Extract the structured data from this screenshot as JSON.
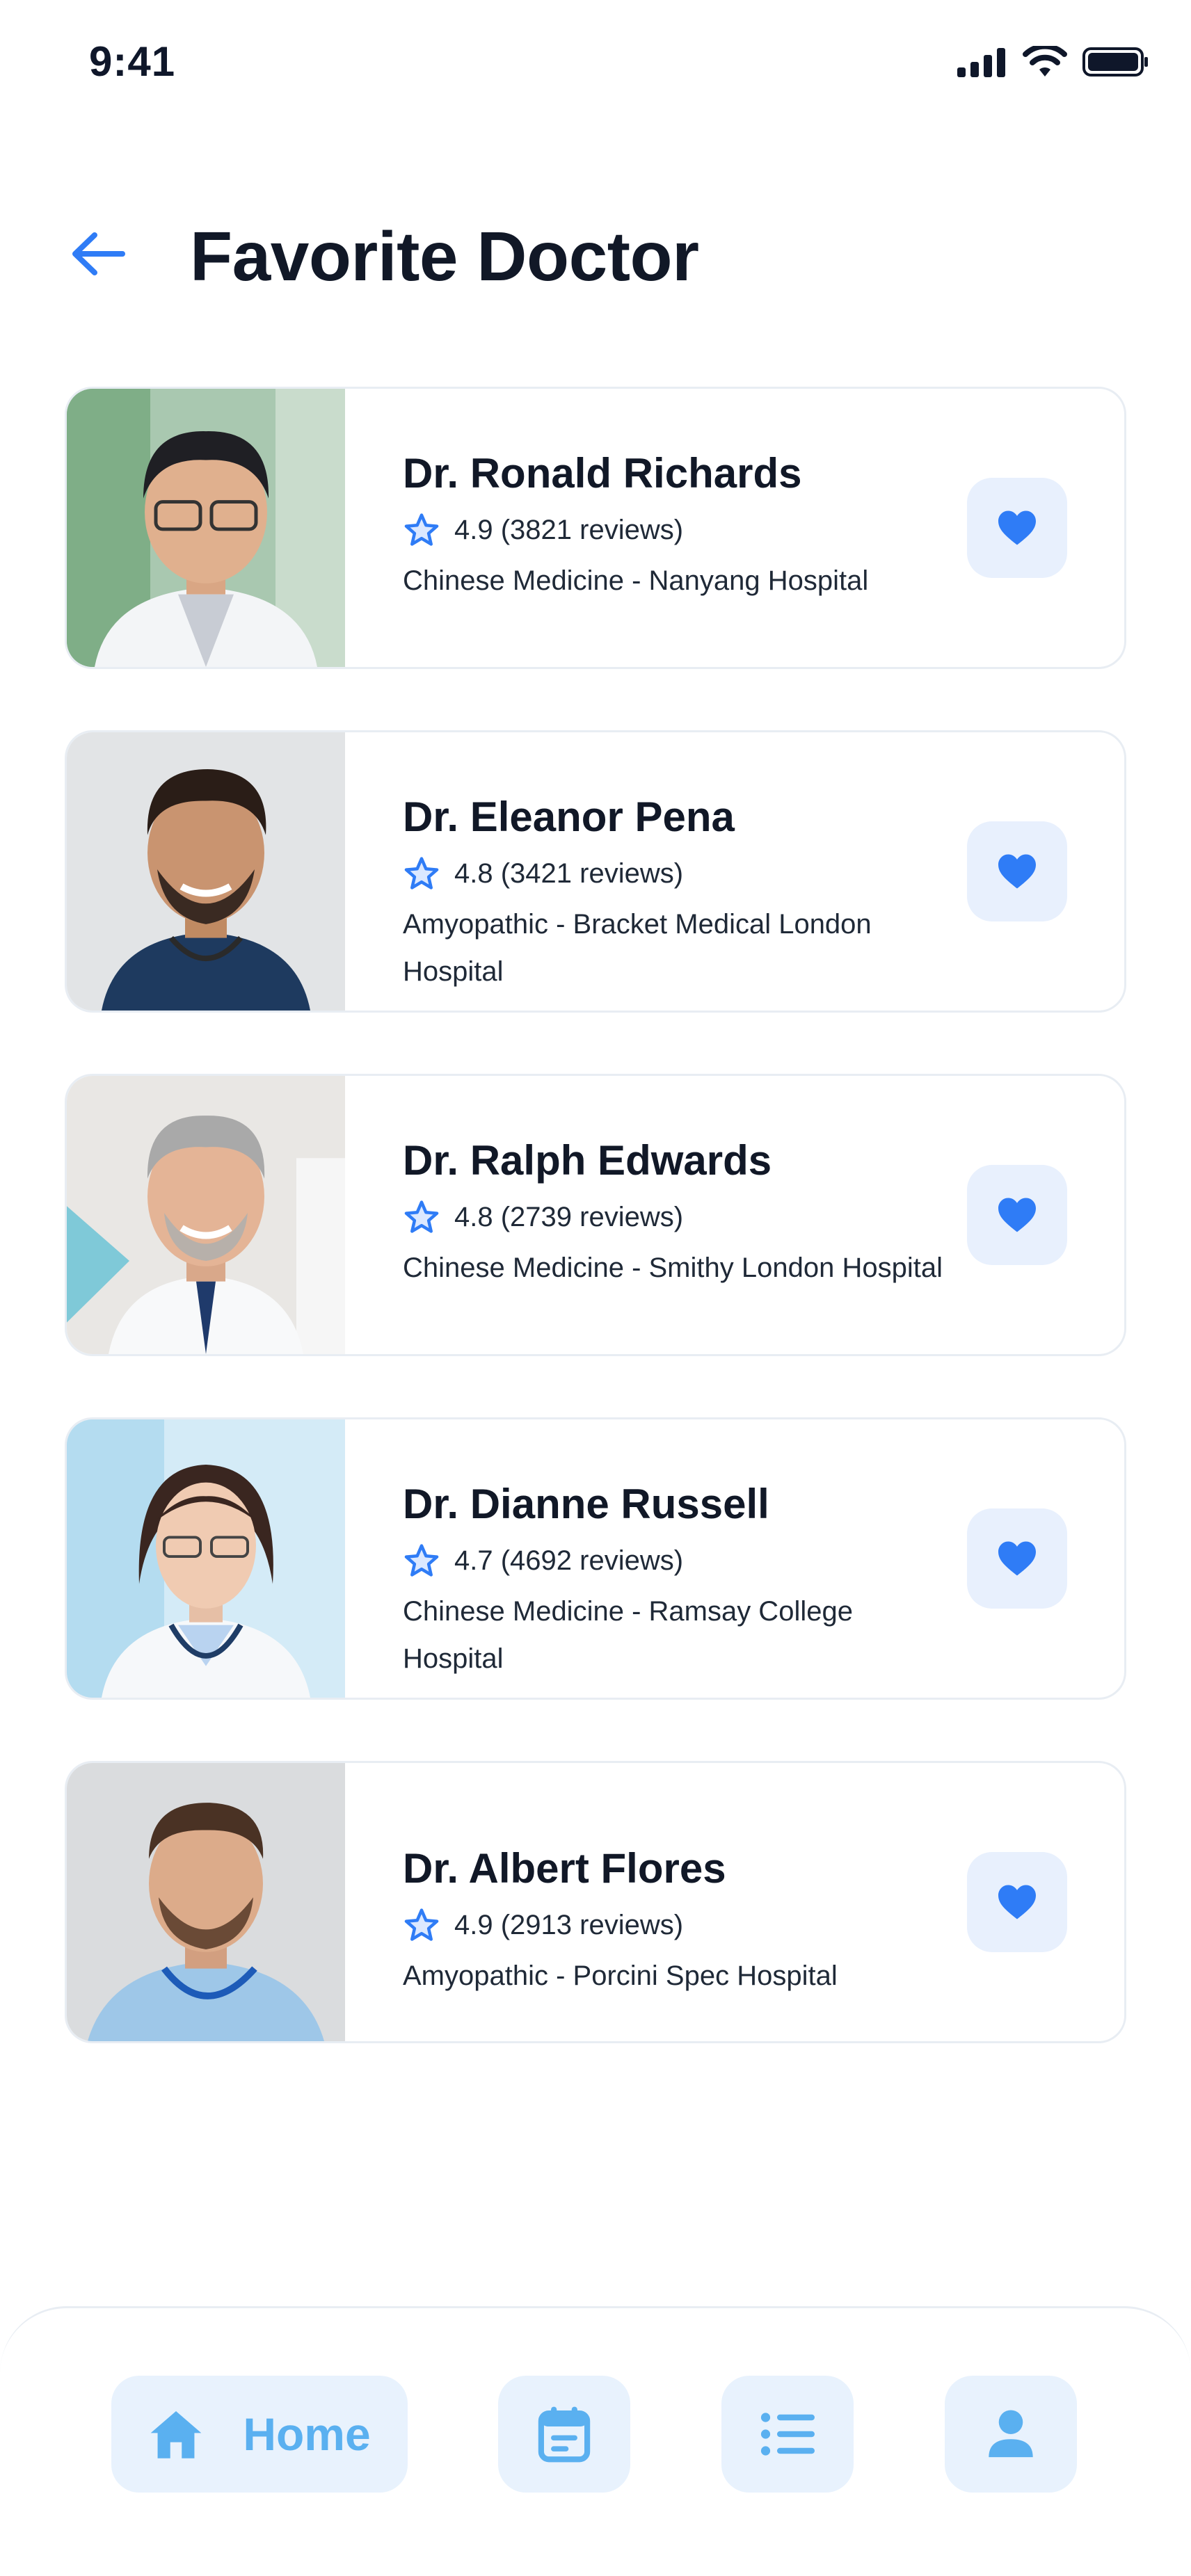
{
  "status_bar": {
    "time": "9:41"
  },
  "header": {
    "title": "Favorite Doctor"
  },
  "doctors": [
    {
      "name": "Dr. Ronald Richards",
      "rating": "4.9 (3821 reviews)",
      "meta": "Chinese Medicine -  Nanyang Hospital"
    },
    {
      "name": "Dr. Eleanor Pena",
      "rating": "4.8 (3421 reviews)",
      "meta": "Amyopathic -  Bracket Medical London Hospital"
    },
    {
      "name": "Dr. Ralph Edwards",
      "rating": "4.8 (2739 reviews)",
      "meta": "Chinese Medicine -  Smithy London Hospital"
    },
    {
      "name": "Dr. Dianne Russell",
      "rating": "4.7 (4692 reviews)",
      "meta": "Chinese Medicine -  Ramsay College Hospital"
    },
    {
      "name": "Dr. Albert Flores",
      "rating": "4.9 (2913 reviews)",
      "meta": "Amyopathic -  Porcini Spec Hospital"
    }
  ],
  "bottom_nav": {
    "home_label": "Home"
  },
  "colors": {
    "accent": "#2f7cf6",
    "light_accent": "#e8f0fd",
    "nav_accent": "#5ab0f0"
  },
  "icons": [
    "back-arrow-icon",
    "star-icon",
    "heart-icon",
    "home-icon",
    "calendar-icon",
    "list-icon",
    "user-icon"
  ]
}
